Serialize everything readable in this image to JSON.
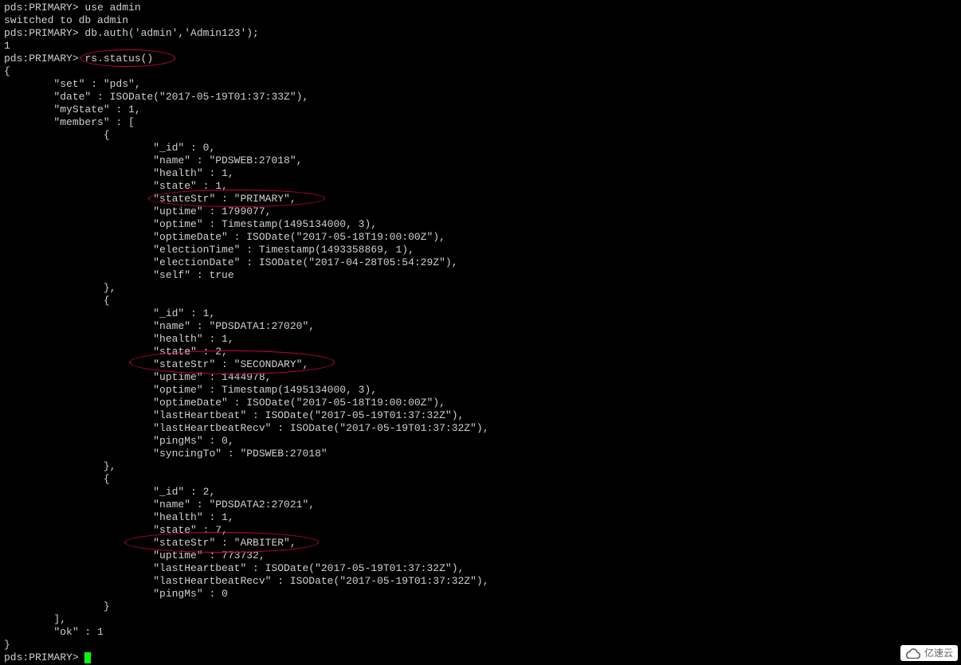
{
  "terminal": {
    "lines": [
      "pds:PRIMARY> use admin",
      "switched to db admin",
      "pds:PRIMARY> db.auth('admin','Admin123');",
      "1",
      "pds:PRIMARY> rs.status()",
      "{",
      "        \"set\" : \"pds\",",
      "        \"date\" : ISODate(\"2017-05-19T01:37:33Z\"),",
      "        \"myState\" : 1,",
      "        \"members\" : [",
      "                {",
      "                        \"_id\" : 0,",
      "                        \"name\" : \"PDSWEB:27018\",",
      "                        \"health\" : 1,",
      "                        \"state\" : 1,",
      "                        \"stateStr\" : \"PRIMARY\",",
      "                        \"uptime\" : 1799077,",
      "                        \"optime\" : Timestamp(1495134000, 3),",
      "                        \"optimeDate\" : ISODate(\"2017-05-18T19:00:00Z\"),",
      "                        \"electionTime\" : Timestamp(1493358869, 1),",
      "                        \"electionDate\" : ISODate(\"2017-04-28T05:54:29Z\"),",
      "                        \"self\" : true",
      "                },",
      "                {",
      "                        \"_id\" : 1,",
      "                        \"name\" : \"PDSDATA1:27020\",",
      "                        \"health\" : 1,",
      "                        \"state\" : 2,",
      "                        \"stateStr\" : \"SECONDARY\",",
      "                        \"uptime\" : 1444978,",
      "                        \"optime\" : Timestamp(1495134000, 3),",
      "                        \"optimeDate\" : ISODate(\"2017-05-18T19:00:00Z\"),",
      "                        \"lastHeartbeat\" : ISODate(\"2017-05-19T01:37:32Z\"),",
      "                        \"lastHeartbeatRecv\" : ISODate(\"2017-05-19T01:37:32Z\"),",
      "                        \"pingMs\" : 0,",
      "                        \"syncingTo\" : \"PDSWEB:27018\"",
      "                },",
      "                {",
      "                        \"_id\" : 2,",
      "                        \"name\" : \"PDSDATA2:27021\",",
      "                        \"health\" : 1,",
      "                        \"state\" : 7,",
      "                        \"stateStr\" : \"ARBITER\",",
      "                        \"uptime\" : 773732,",
      "                        \"lastHeartbeat\" : ISODate(\"2017-05-19T01:37:32Z\"),",
      "                        \"lastHeartbeatRecv\" : ISODate(\"2017-05-19T01:37:32Z\"),",
      "                        \"pingMs\" : 0",
      "                }",
      "        ],",
      "        \"ok\" : 1",
      "}",
      "pds:PRIMARY> "
    ],
    "prompt_cursor": true
  },
  "watermark": {
    "text": "亿速云"
  }
}
